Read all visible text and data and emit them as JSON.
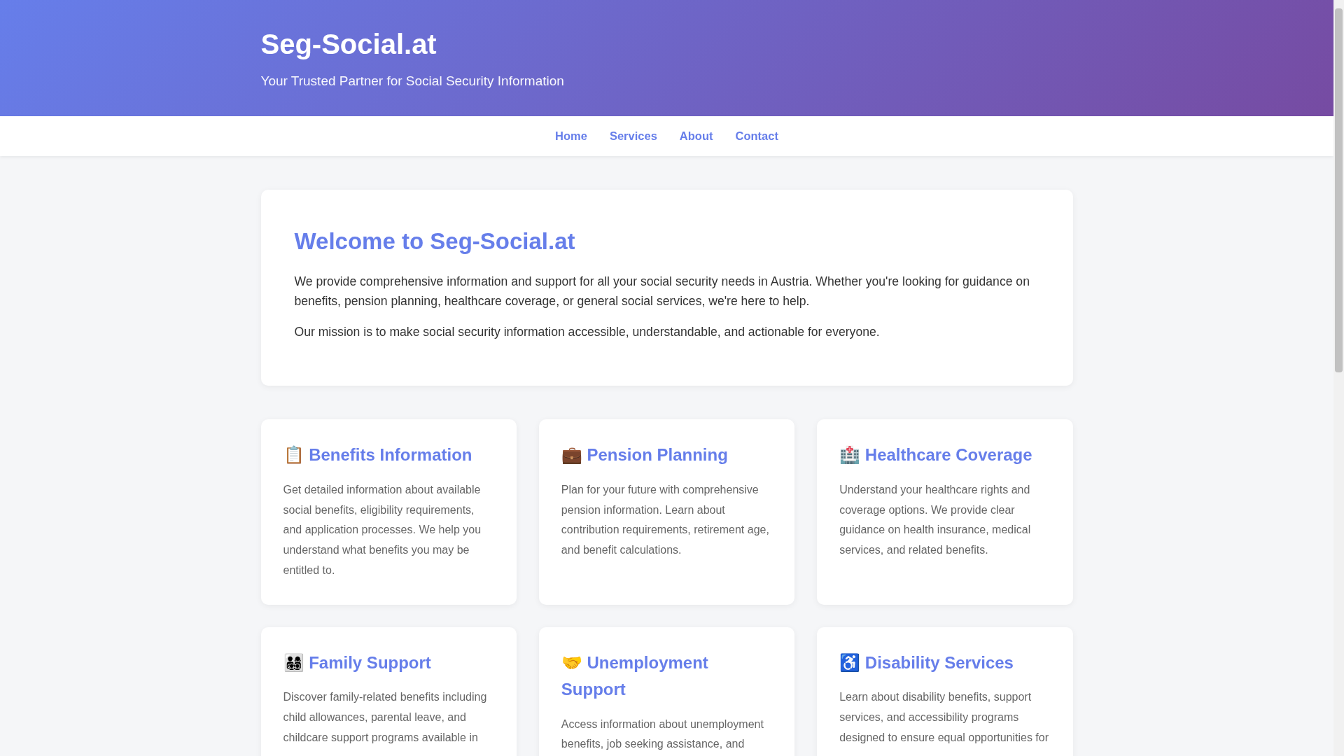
{
  "header": {
    "title": "Seg-Social.at",
    "tagline": "Your Trusted Partner for Social Security Information"
  },
  "nav": [
    {
      "label": "Home"
    },
    {
      "label": "Services"
    },
    {
      "label": "About"
    },
    {
      "label": "Contact"
    }
  ],
  "welcome": {
    "heading": "Welcome to Seg-Social.at",
    "paragraphs": [
      "We provide comprehensive information and support for all your social security needs in Austria. Whether you're looking for guidance on benefits, pension planning, healthcare coverage, or general social services, we're here to help.",
      "Our mission is to make social security information accessible, understandable, and actionable for everyone."
    ]
  },
  "services": [
    {
      "emoji": "📋",
      "title": "Benefits Information",
      "text": "Get detailed information about available social benefits, eligibility requirements, and application processes. We help you understand what benefits you may be entitled to."
    },
    {
      "emoji": "💼",
      "title": "Pension Planning",
      "text": "Plan for your future with comprehensive pension information. Learn about contribution requirements, retirement age, and benefit calculations."
    },
    {
      "emoji": "🏥",
      "title": "Healthcare Coverage",
      "text": "Understand your healthcare rights and coverage options. We provide clear guidance on health insurance, medical services, and related benefits."
    },
    {
      "emoji": "👨‍👩‍👧‍👦",
      "title": "Family Support",
      "text": "Discover family-related benefits including child allowances, parental leave, and childcare support programs available in"
    },
    {
      "emoji": "🤝",
      "title": "Unemployment Support",
      "text": "Access information about unemployment benefits, job seeking assistance, and"
    },
    {
      "emoji": "♿",
      "title": "Disability Services",
      "text": "Learn about disability benefits, support services, and accessibility programs designed to ensure equal opportunities for"
    }
  ]
}
